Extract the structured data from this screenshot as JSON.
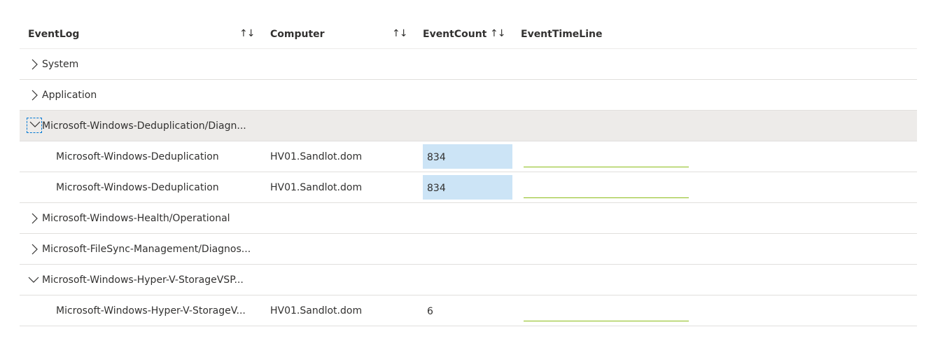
{
  "colors": {
    "header_text": "#323130",
    "row_border": "#e1dfdd",
    "selected_row_bg": "#edebe9",
    "count_bar": "#cce4f6",
    "timeline_line": "#8cbd18",
    "focus_outline": "#0078d4"
  },
  "columns": {
    "eventlog": "EventLog",
    "computer": "Computer",
    "eventcount": "EventCount",
    "eventtimeline": "EventTimeLine",
    "sort_icon": "↑↓"
  },
  "groups": [
    {
      "label": "System",
      "expanded": false
    },
    {
      "label": "Application",
      "expanded": false
    },
    {
      "label": "Microsoft-Windows-Deduplication/Diagn...",
      "expanded": true,
      "selected": true,
      "rows": [
        {
          "eventlog": "Microsoft-Windows-Deduplication",
          "computer": "HV01.Sandlot.dom",
          "eventcount": "834"
        },
        {
          "eventlog": "Microsoft-Windows-Deduplication",
          "computer": "HV01.Sandlot.dom",
          "eventcount": "834"
        }
      ]
    },
    {
      "label": "Microsoft-Windows-Health/Operational",
      "expanded": false
    },
    {
      "label": "Microsoft-FileSync-Management/Diagnos...",
      "expanded": false
    },
    {
      "label": "Microsoft-Windows-Hyper-V-StorageVSP...",
      "expanded": true,
      "rows": [
        {
          "eventlog": "Microsoft-Windows-Hyper-V-StorageV...",
          "computer": "HV01.Sandlot.dom",
          "eventcount": "6"
        }
      ]
    }
  ]
}
